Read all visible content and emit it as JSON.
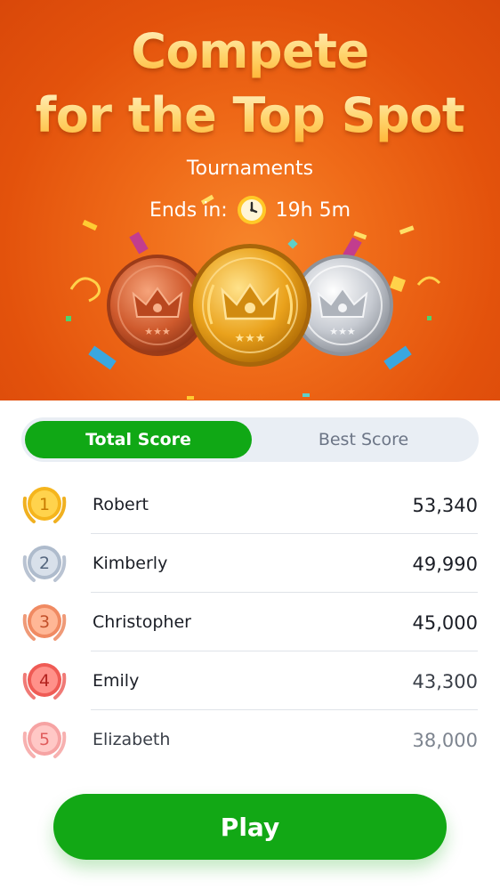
{
  "hero": {
    "headline_line1": "Compete",
    "headline_line2": "for the Top Spot",
    "subtitle": "Tournaments",
    "ends_label": "Ends in:",
    "ends_time": "19h 5m",
    "clock_icon": "clock-icon",
    "medals": [
      "bronze-crown-medal-icon",
      "gold-crown-medal-icon",
      "silver-crown-medal-icon"
    ]
  },
  "tabs": {
    "active": "Total Score",
    "inactive": "Best Score"
  },
  "leaderboard": [
    {
      "rank": "1",
      "name": "Robert",
      "score": "53,340",
      "badge": "gold"
    },
    {
      "rank": "2",
      "name": "Kimberly",
      "score": "49,990",
      "badge": "silver"
    },
    {
      "rank": "3",
      "name": "Christopher",
      "score": "45,000",
      "badge": "bronze"
    },
    {
      "rank": "4",
      "name": "Emily",
      "score": "43,300",
      "badge": "red"
    },
    {
      "rank": "5",
      "name": "Elizabeth",
      "score": "38,000",
      "badge": "pink"
    }
  ],
  "play_label": "Play",
  "colors": {
    "hero_orange": "#e3520c",
    "accent_green": "#12a815",
    "gold_text": "#ffd56e"
  }
}
